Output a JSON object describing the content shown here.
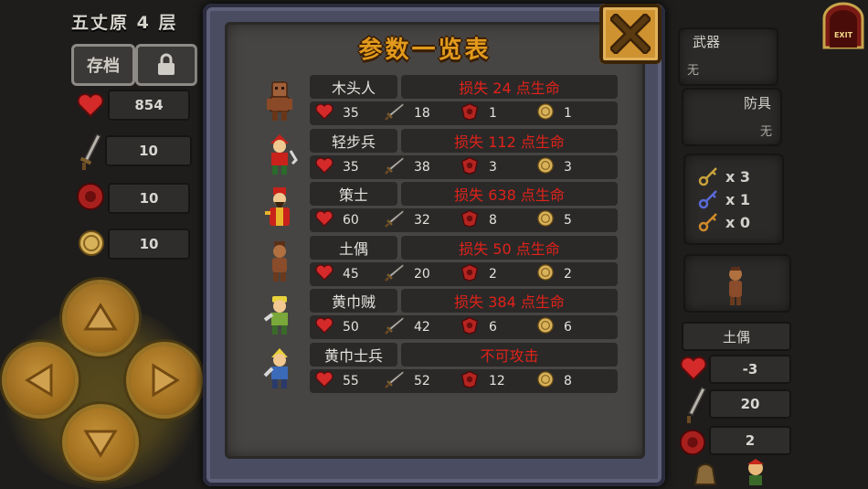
{
  "left_panel": {
    "floor_title": "五丈原 4 层",
    "save_button": "存档",
    "lock_button": "",
    "stats": {
      "hp": "854",
      "attack": "10",
      "defense": "10",
      "gold": "10"
    }
  },
  "modal": {
    "title": "参数一览表",
    "monsters": [
      {
        "name": "木头人",
        "damage": "损失 24 点生命",
        "hp": "35",
        "atk": "18",
        "def": "1",
        "gold": "1"
      },
      {
        "name": "轻步兵",
        "damage": "损失 112 点生命",
        "hp": "35",
        "atk": "38",
        "def": "3",
        "gold": "3"
      },
      {
        "name": "策士",
        "damage": "损失 638 点生命",
        "hp": "60",
        "atk": "32",
        "def": "8",
        "gold": "5"
      },
      {
        "name": "土偶",
        "damage": "损失 50 点生命",
        "hp": "45",
        "atk": "20",
        "def": "2",
        "gold": "2"
      },
      {
        "name": "黄巾贼",
        "damage": "损失 384 点生命",
        "hp": "50",
        "atk": "42",
        "def": "6",
        "gold": "6"
      },
      {
        "name": "黄巾士兵",
        "damage": "不可攻击",
        "hp": "55",
        "atk": "52",
        "def": "12",
        "gold": "8"
      }
    ]
  },
  "right_panel": {
    "exit_label": "EXIT",
    "weapon_label": "武器",
    "weapon_value": "无",
    "armor_label": "防具",
    "armor_value": "无",
    "keys": [
      {
        "color": "#c9a23a",
        "count": "x 3"
      },
      {
        "color": "#5a6ad8",
        "count": "x 1"
      },
      {
        "color": "#d08a2a",
        "count": "x 0"
      }
    ],
    "target": {
      "name": "土偶",
      "hp": "-3",
      "atk": "20",
      "def": "2"
    }
  },
  "colors": {
    "damage_text": "#e0221a",
    "title_gold": "#e29a1c",
    "modal_border": "#4a4c62"
  }
}
